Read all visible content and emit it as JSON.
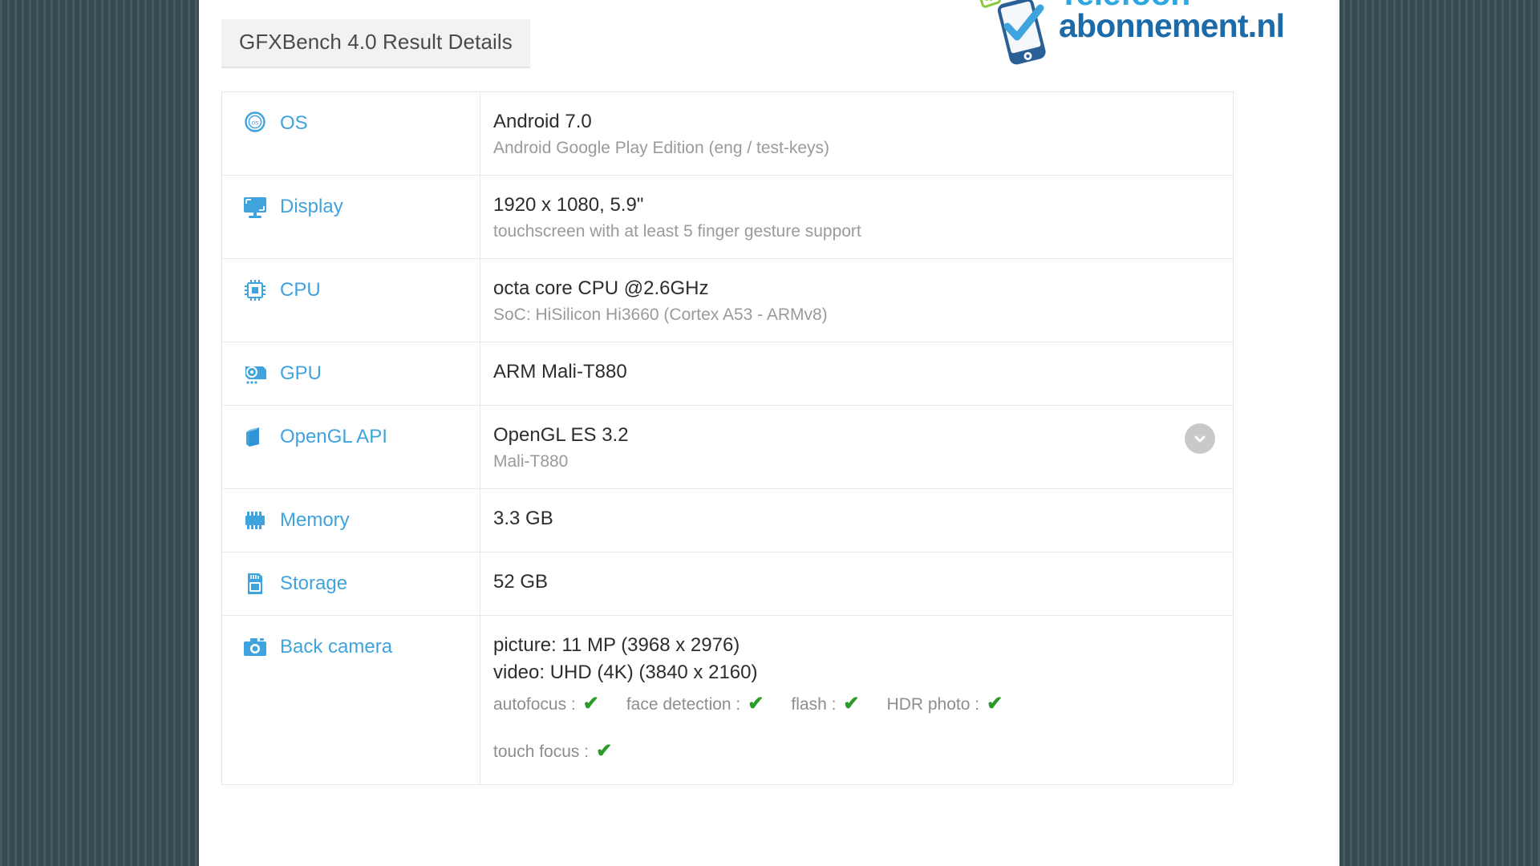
{
  "page": {
    "title": "GFXBench 4.0 Result Details"
  },
  "logo": {
    "line1": "Telefoon",
    "line2": "abonnement.nl",
    "color_line1": "#2ca7e0",
    "color_line2": "#1c6aa8",
    "check_color": "#3fa3dd",
    "phone_color": "#2a5f96",
    "tag_color": "#8cc63f"
  },
  "colors": {
    "label_blue": "#3fa3dd",
    "value_dark": "#2d2d2d",
    "value_gray": "#9a9a9a",
    "check_green": "#2a9a2a",
    "background": "#3b5058"
  },
  "specs": [
    {
      "icon": "os-icon",
      "label": "OS",
      "value_main": "Android 7.0",
      "value_sub": "Android Google Play Edition (eng / test-keys)"
    },
    {
      "icon": "display-icon",
      "label": "Display",
      "value_main": "1920 x 1080, 5.9\"",
      "value_sub": "touchscreen with at least 5 finger gesture support"
    },
    {
      "icon": "cpu-icon",
      "label": "CPU",
      "value_main": "octa core CPU @2.6GHz",
      "value_sub": "SoC: HiSilicon Hi3660 (Cortex A53 - ARMv8)"
    },
    {
      "icon": "gpu-icon",
      "label": "GPU",
      "value_main": "ARM Mali-T880",
      "value_sub": ""
    },
    {
      "icon": "opengl-icon",
      "label": "OpenGL API",
      "value_main": "OpenGL ES 3.2",
      "value_sub": "Mali-T880",
      "expandable": true
    },
    {
      "icon": "memory-icon",
      "label": "Memory",
      "value_main": "3.3 GB",
      "value_sub": ""
    },
    {
      "icon": "storage-icon",
      "label": "Storage",
      "value_main": "52 GB",
      "value_sub": ""
    }
  ],
  "camera": {
    "icon": "camera-icon",
    "label": "Back camera",
    "picture": "picture: 11 MP (3968 x 2976)",
    "video": "video: UHD (4K) (3840 x 2160)",
    "features_row1": [
      {
        "label": "autofocus :",
        "supported": "✔"
      },
      {
        "label": "face detection :",
        "supported": "✔"
      },
      {
        "label": "flash :",
        "supported": "✔"
      },
      {
        "label": "HDR photo :",
        "supported": "✔"
      }
    ],
    "features_row2": [
      {
        "label": "touch focus :",
        "supported": "✔"
      }
    ]
  }
}
